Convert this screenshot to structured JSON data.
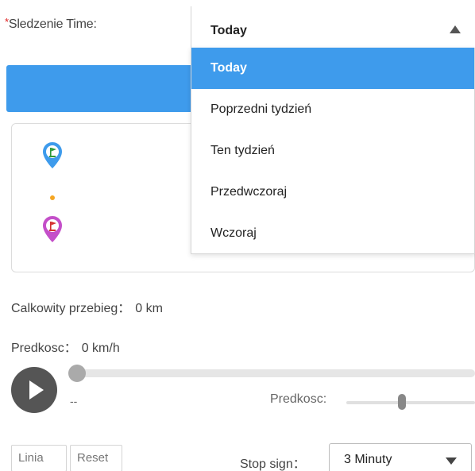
{
  "time_filter": {
    "required_mark": "*",
    "label": "Sledzenie Time:",
    "selected": "Today",
    "options": [
      {
        "label": "Today",
        "selected": true
      },
      {
        "label": "Poprzedni tydzień",
        "selected": false
      },
      {
        "label": "Ten tydzień",
        "selected": false
      },
      {
        "label": "Przedwczoraj",
        "selected": false
      },
      {
        "label": "Wczoraj",
        "selected": false
      }
    ]
  },
  "route": {
    "start_icon": "start-flag-pin-icon",
    "end_icon": "end-flag-pin-icon",
    "start_color": "#3e9bec",
    "end_color": "#c44fc9"
  },
  "stats": {
    "mileage_label": "Calkowity przebieg：",
    "mileage_value": "0 km",
    "speed_label": "Predkosc：",
    "speed_value": "0 km/h"
  },
  "player": {
    "play_icon": "play-icon",
    "time_readout": "--",
    "progress": 0,
    "speed_label": "Predkosc:",
    "speed_level": 0.43
  },
  "buttons": {
    "linia": "Linia",
    "reset": "Reset"
  },
  "stop_sign": {
    "label": "Stop sign：",
    "selected": "3 Minuty"
  },
  "colors": {
    "accent": "#3e9bec",
    "play_button": "#555555"
  }
}
